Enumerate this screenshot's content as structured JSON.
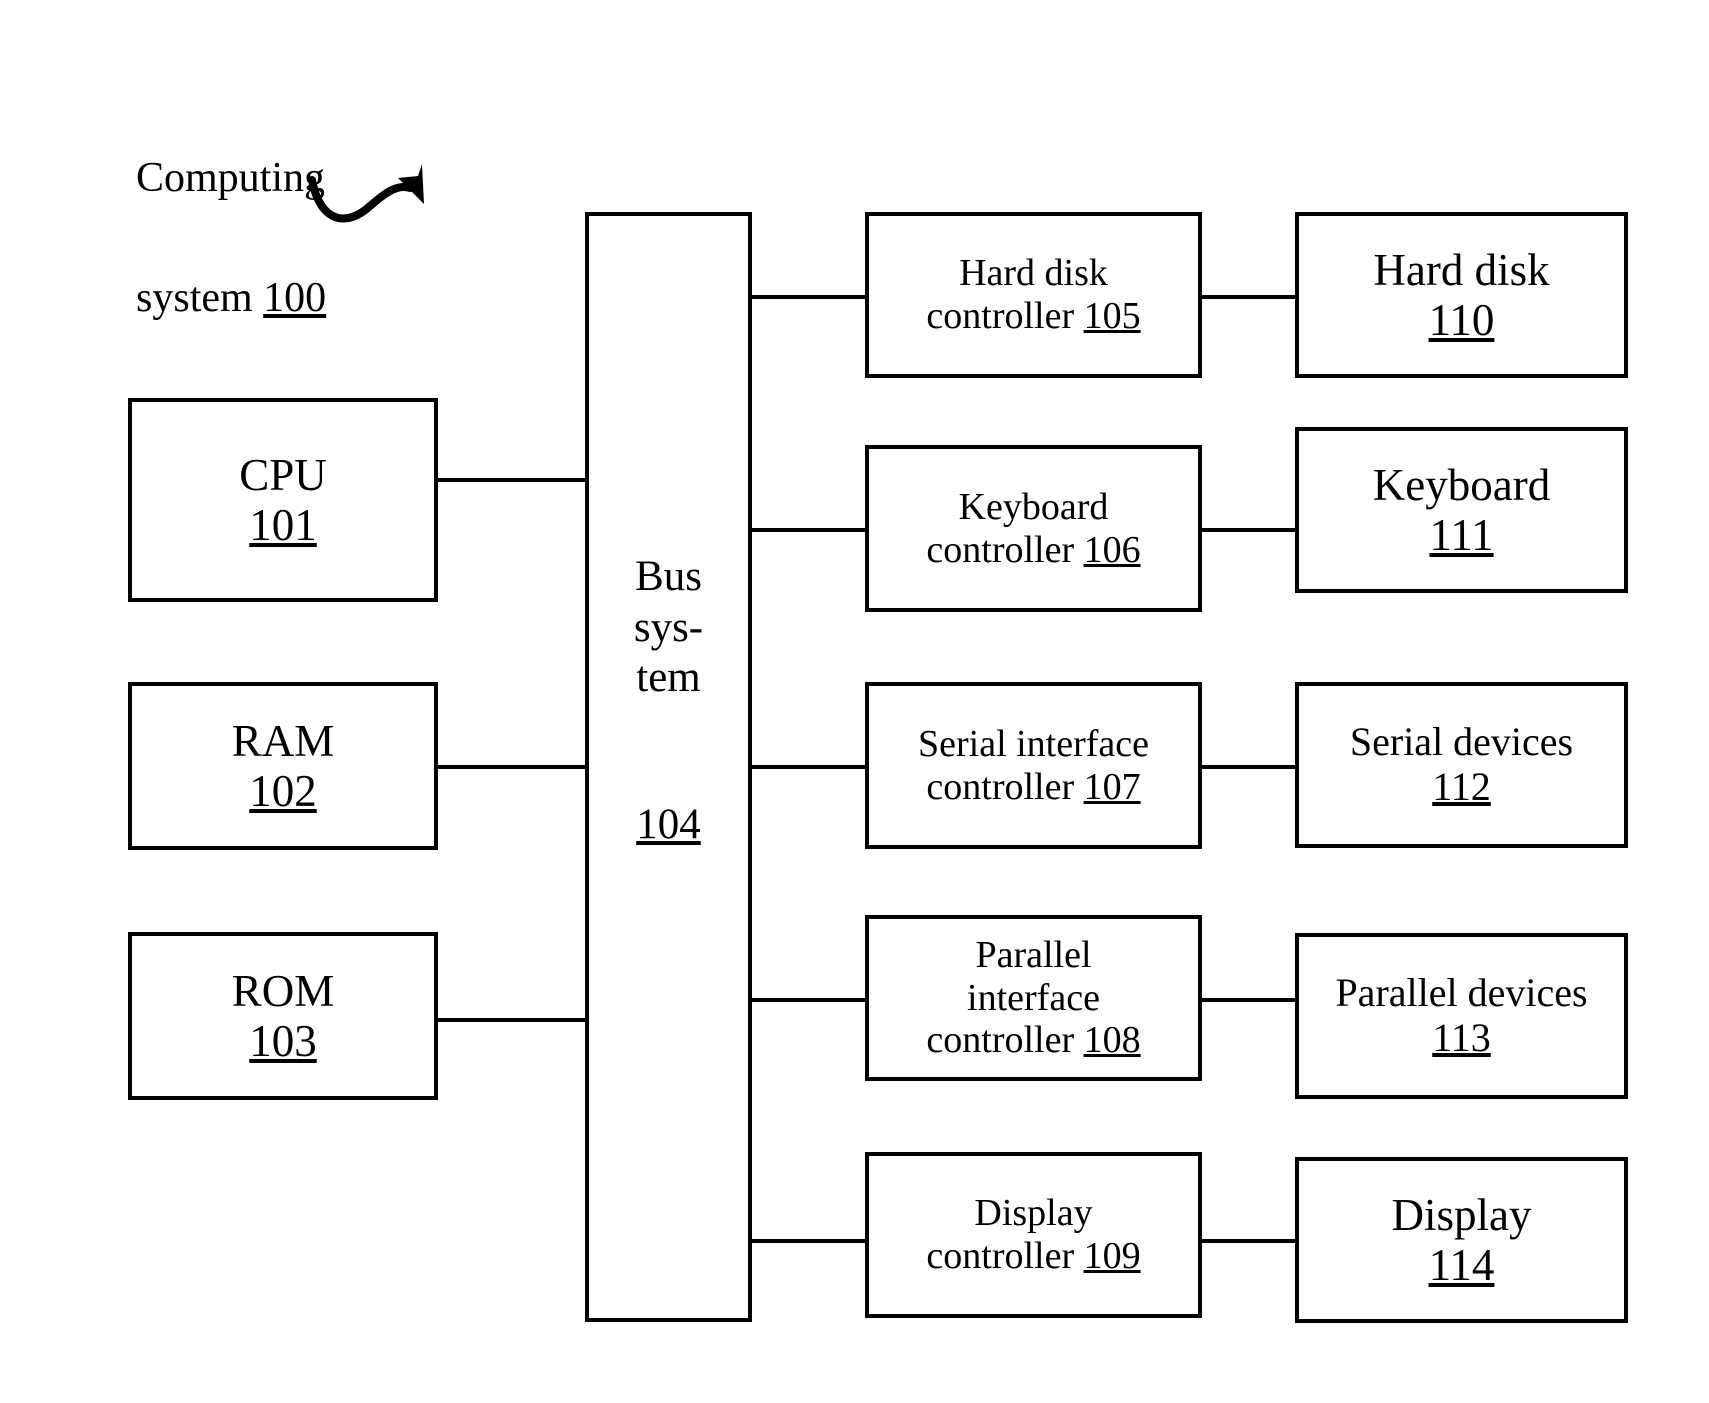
{
  "figure": {
    "title_line1": "Computing",
    "title_line2_text": "system ",
    "title_line2_ref": "100",
    "arrow_name": "curved-pointer-arrow"
  },
  "bus": {
    "name": "Bus\nsys-\ntem",
    "ref": "104"
  },
  "left_column": [
    {
      "name": "CPU",
      "ref": "101"
    },
    {
      "name": "RAM",
      "ref": "102"
    },
    {
      "name": "ROM",
      "ref": "103"
    }
  ],
  "controller_column": [
    {
      "name": "Hard disk\ncontroller ",
      "ref": "105"
    },
    {
      "name": "Keyboard\ncontroller ",
      "ref": "106"
    },
    {
      "name": "Serial interface\ncontroller ",
      "ref": "107"
    },
    {
      "name": "Parallel\ninterface\ncontroller ",
      "ref": "108"
    },
    {
      "name": "Display\ncontroller ",
      "ref": "109"
    }
  ],
  "device_column": [
    {
      "name": "Hard disk\n",
      "ref": "110"
    },
    {
      "name": "Keyboard\n",
      "ref": "111"
    },
    {
      "name": "Serial devices\n",
      "ref": "112"
    },
    {
      "name": "Parallel devices\n",
      "ref": "113"
    },
    {
      "name": "Display\n",
      "ref": "114"
    }
  ],
  "colors": {
    "stroke": "#000000",
    "background": "#ffffff"
  }
}
